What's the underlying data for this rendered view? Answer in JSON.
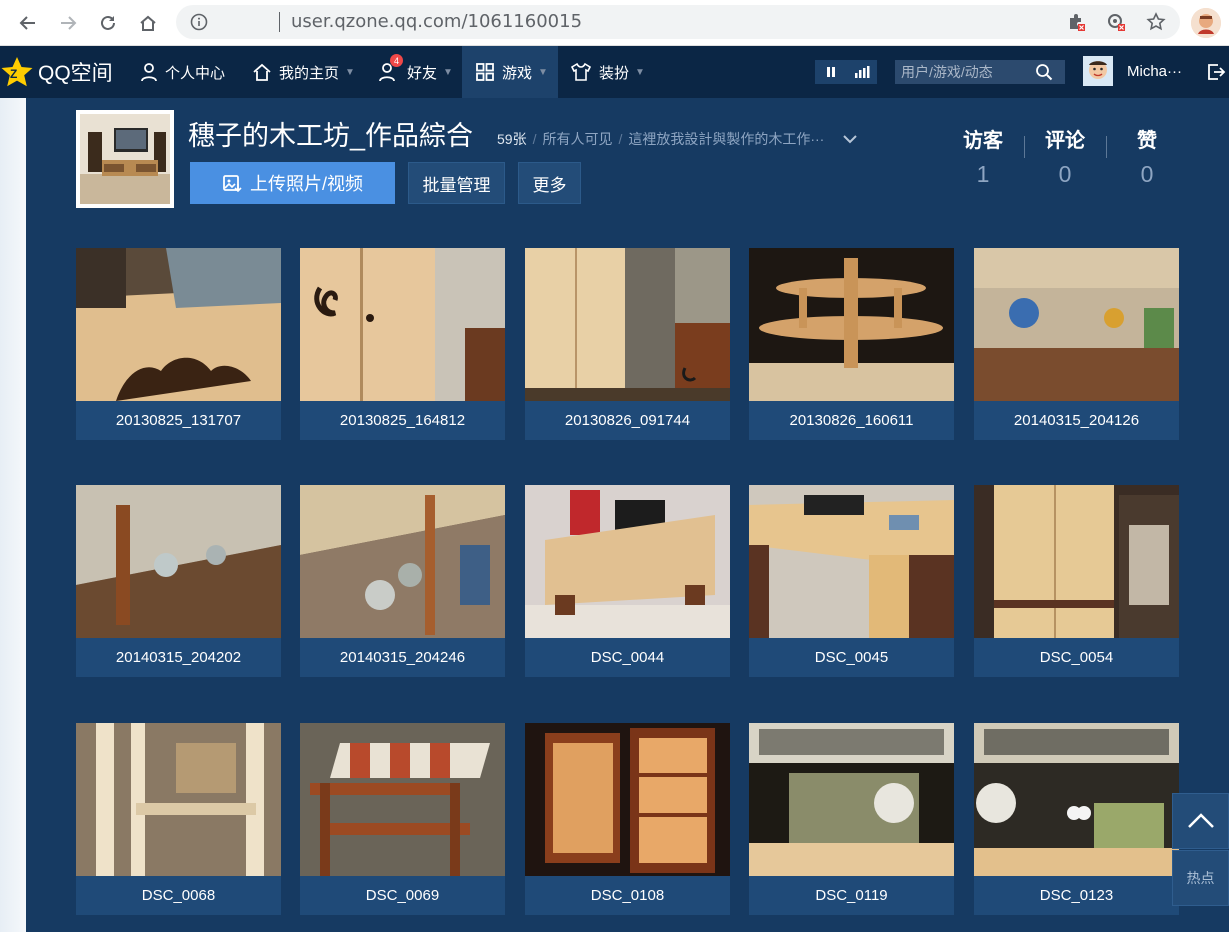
{
  "browser": {
    "url": "user.qzone.qq.com/1061160015",
    "icons": [
      "back-icon",
      "forward-icon",
      "reload-icon",
      "home-icon",
      "info-icon",
      "extension-icon",
      "shield-icon",
      "star-icon"
    ]
  },
  "qzone_nav": {
    "logo": "QQ空间",
    "items": [
      {
        "label": "个人中心",
        "icon": "person-icon"
      },
      {
        "label": "我的主页",
        "icon": "home-icon"
      },
      {
        "label": "好友",
        "icon": "friends-icon",
        "badge": "4"
      },
      {
        "label": "游戏",
        "icon": "grid-icon"
      },
      {
        "label": "装扮",
        "icon": "shirt-icon"
      }
    ],
    "search_placeholder": "用户/游戏/动态",
    "username": "Micha···"
  },
  "album": {
    "title": "穗子的木工坊_作品綜合",
    "count": "59张",
    "visibility": "所有人可见",
    "description": "這裡放我設計與製作的木工作···",
    "upload_button": "上传照片/视频",
    "manage_button": "批量管理",
    "more_button": "更多"
  },
  "stats": [
    {
      "label": "访客",
      "value": "1"
    },
    {
      "label": "评论",
      "value": "0"
    },
    {
      "label": "赞",
      "value": "0"
    }
  ],
  "photos": [
    {
      "name": "20130825_131707"
    },
    {
      "name": "20130825_164812"
    },
    {
      "name": "20130826_091744"
    },
    {
      "name": "20130826_160611"
    },
    {
      "name": "20140315_204126"
    },
    {
      "name": "20140315_204202"
    },
    {
      "name": "20140315_204246"
    },
    {
      "name": "DSC_0044"
    },
    {
      "name": "DSC_0045"
    },
    {
      "name": "DSC_0054"
    },
    {
      "name": "DSC_0068"
    },
    {
      "name": "DSC_0069"
    },
    {
      "name": "DSC_0108"
    },
    {
      "name": "DSC_0119"
    },
    {
      "name": "DSC_0123"
    }
  ],
  "float": {
    "hot_label": "热点"
  }
}
